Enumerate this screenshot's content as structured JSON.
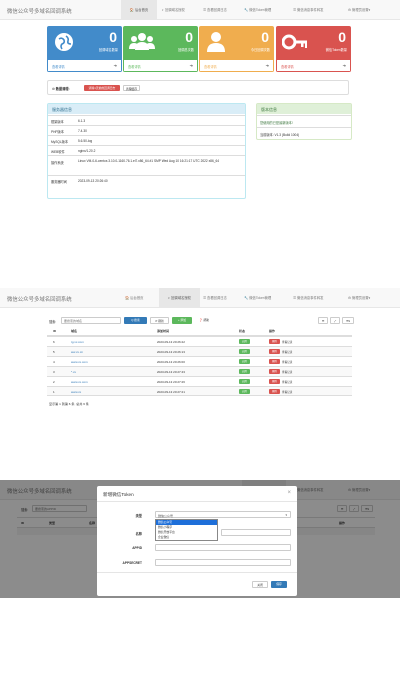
{
  "app_title": "微信公众号多域名回调系统",
  "nav": [
    {
      "icon": "🏠",
      "label": "后台首页"
    },
    {
      "icon": "◐",
      "label": "回调域名授权"
    },
    {
      "icon": "☰",
      "label": "查看回调日志"
    },
    {
      "icon": "🔧",
      "label": "微信Token管理"
    },
    {
      "icon": "☰",
      "label": "微信消息事件转发"
    },
    {
      "icon": "⚙",
      "label": "管理员设置▾"
    }
  ],
  "dashboard": {
    "stats": [
      {
        "value": "0",
        "label": "回调域名数量",
        "link": "查看详情",
        "color": "#428bca",
        "icon": "globe-icon"
      },
      {
        "value": "0",
        "label": "回调总次数",
        "link": "查看详情",
        "color": "#5cb85c",
        "icon": "users-icon"
      },
      {
        "value": "0",
        "label": "今日回调次数",
        "link": "查看详情",
        "color": "#f0ad4e",
        "icon": "user-icon"
      },
      {
        "value": "0",
        "label": "微信Token数量",
        "link": "查看详情",
        "color": "#d9534f",
        "icon": "key-icon"
      }
    ],
    "quick": {
      "label": "数据清理:",
      "btn1": "清除1天前的回调日志",
      "btn2": "清理缓存"
    },
    "server_info": {
      "title": "服务器信息",
      "rows": [
        {
          "k": "框架版本",
          "v": "6.1.3"
        },
        {
          "k": "PHP版本",
          "v": "7.4.30"
        },
        {
          "k": "MySQL版本",
          "v": "5.6.50-log"
        },
        {
          "k": "WEB软件",
          "v": "nginx/1.20.2"
        },
        {
          "k": "操作系统",
          "v": "Linux VM-0-6-centos 3.10.0-1160.76.1.el7.x86_64 #1 SMP Wed Aug 10 16:21:17 UTC 2022 x86_64"
        },
        {
          "k": "服务器时间",
          "v": "2023-09-13 20:26:40"
        }
      ]
    },
    "version_info": {
      "title": "版本信息",
      "latest": "您使用的已是最新版本!",
      "current": "当前版本: V1.3 (Build 1004)"
    }
  },
  "domains": {
    "search_label": "搜索:",
    "search_placeholder": "要搜索的域名",
    "search_btn": "Q 搜索",
    "refresh_btn": "⟳ 刷新",
    "add_btn": "+ 添加",
    "help_btn": "❓ 帮助",
    "columns": [
      "ID",
      "域名",
      "添加时间",
      "状态",
      "操作"
    ],
    "rows": [
      {
        "id": "6",
        "domain": "tg.xx.com",
        "time": "2023-09-13 20:26:22",
        "status": "启用",
        "op1": "删除",
        "op2": "查看记录"
      },
      {
        "id": "5",
        "domain": "ww.xx.cn",
        "time": "2023-09-13 20:26:13",
        "status": "启用",
        "op1": "删除",
        "op2": "查看记录"
      },
      {
        "id": "4",
        "domain": "www.xx.com",
        "time": "2023-09-13 20:26:00",
        "status": "启用",
        "op1": "删除",
        "op2": "查看记录"
      },
      {
        "id": "3",
        "domain": "*.xx",
        "time": "2023-09-13 20:27:43",
        "status": "启用",
        "op1": "删除",
        "op2": "查看记录"
      },
      {
        "id": "2",
        "domain": "www.xx.com",
        "time": "2023-09-13 20:27:26",
        "status": "启用",
        "op1": "删除",
        "op2": "查看记录"
      },
      {
        "id": "1",
        "domain": "www.xx",
        "time": "2023-09-13 20:27:21",
        "status": "启用",
        "op1": "删除",
        "op2": "查看记录"
      }
    ],
    "summary": "显示第 1 到第 6 条, 总共 6 条"
  },
  "token": {
    "search_label": "搜索:",
    "search_placeholder": "要搜索的APPID",
    "columns": [
      "ID",
      "类型",
      "名称",
      "操作"
    ],
    "modal": {
      "title": "新增微信Token",
      "close": "×",
      "type_label": "类型",
      "type_value": "微信公众号",
      "type_options": [
        "微信公众号",
        "微信小程序",
        "微信开放平台",
        "企业微信"
      ],
      "name_label": "名称",
      "appid_label": "APPID",
      "secret_label": "APPSECRET",
      "cancel_btn": "关闭",
      "save_btn": "保存"
    }
  },
  "colors": {
    "primary": "#337ab7",
    "success": "#5cb85c",
    "warning": "#f0ad4e",
    "danger": "#d9534f"
  }
}
